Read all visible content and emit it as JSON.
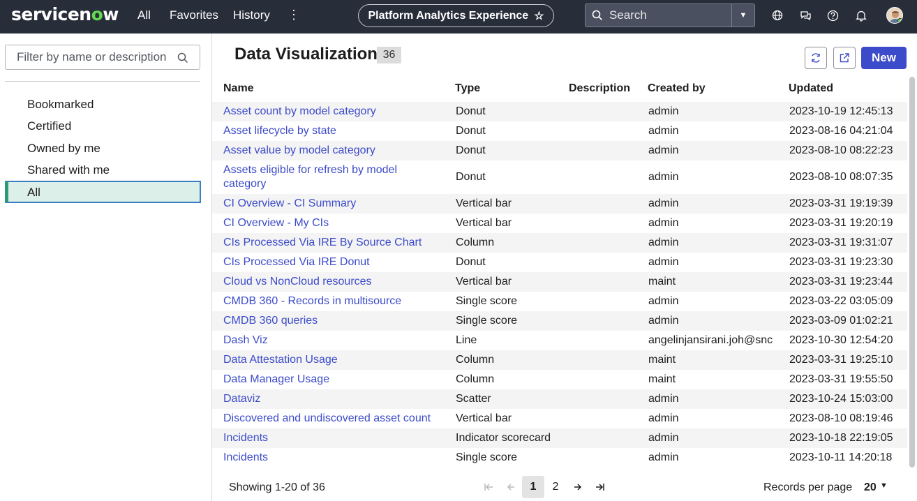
{
  "topbar": {
    "logo_text_pre": "servicen",
    "logo_text_o": "o",
    "logo_text_post": "w",
    "nav": [
      "All",
      "Favorites",
      "History"
    ],
    "app_name": "Platform Analytics Experience",
    "search_placeholder": "Search",
    "colors": {
      "bar": "#282d3a",
      "logo_accent": "#62d84e"
    }
  },
  "sidebar": {
    "filter_placeholder": "Filter by name or description",
    "items": [
      "Bookmarked",
      "Certified",
      "Owned by me",
      "Shared with me",
      "All"
    ],
    "active": "All"
  },
  "main": {
    "title": "Data Visualizations",
    "count": "36",
    "new_label": "New",
    "columns": [
      "Name",
      "Type",
      "Description",
      "Created by",
      "Updated"
    ],
    "rows": [
      {
        "name": "Asset count by model category",
        "type": "Donut",
        "created_by": "admin",
        "updated": "2023-10-19 12:45:13"
      },
      {
        "name": "Asset lifecycle by state",
        "type": "Donut",
        "created_by": "admin",
        "updated": "2023-08-16 04:21:04"
      },
      {
        "name": "Asset value by model category",
        "type": "Donut",
        "created_by": "admin",
        "updated": "2023-08-10 08:22:23"
      },
      {
        "name": "Assets eligible for refresh by model category",
        "type": "Donut",
        "created_by": "admin",
        "updated": "2023-08-10 08:07:35"
      },
      {
        "name": "CI Overview - CI Summary",
        "type": "Vertical bar",
        "created_by": "admin",
        "updated": "2023-03-31 19:19:39"
      },
      {
        "name": "CI Overview - My CIs",
        "type": "Vertical bar",
        "created_by": "admin",
        "updated": "2023-03-31 19:20:19"
      },
      {
        "name": "CIs Processed Via IRE By Source Chart",
        "type": "Column",
        "created_by": "admin",
        "updated": "2023-03-31 19:31:07"
      },
      {
        "name": "CIs Processed Via IRE Donut",
        "type": "Donut",
        "created_by": "admin",
        "updated": "2023-03-31 19:23:30"
      },
      {
        "name": "Cloud vs NonCloud resources",
        "type": "Vertical bar",
        "created_by": "maint",
        "updated": "2023-03-31 19:23:44"
      },
      {
        "name": "CMDB 360 - Records in multisource",
        "type": "Single score",
        "created_by": "admin",
        "updated": "2023-03-22 03:05:09"
      },
      {
        "name": "CMDB 360 queries",
        "type": "Single score",
        "created_by": "admin",
        "updated": "2023-03-09 01:02:21"
      },
      {
        "name": "Dash Viz",
        "type": "Line",
        "created_by": "angelinjansirani.joh@snc",
        "updated": "2023-10-30 12:54:20"
      },
      {
        "name": "Data Attestation Usage",
        "type": "Column",
        "created_by": "maint",
        "updated": "2023-03-31 19:25:10"
      },
      {
        "name": "Data Manager Usage",
        "type": "Column",
        "created_by": "maint",
        "updated": "2023-03-31 19:55:50"
      },
      {
        "name": "Dataviz",
        "type": "Scatter",
        "created_by": "admin",
        "updated": "2023-10-24 15:03:00"
      },
      {
        "name": "Discovered and undiscovered asset count",
        "type": "Vertical bar",
        "created_by": "admin",
        "updated": "2023-08-10 08:19:46"
      },
      {
        "name": "Incidents",
        "type": "Indicator scorecard",
        "created_by": "admin",
        "updated": "2023-10-18 22:19:05"
      },
      {
        "name": "Incidents",
        "type": "Single score",
        "created_by": "admin",
        "updated": "2023-10-11 14:20:18"
      }
    ],
    "link_color": "#3c4bc9"
  },
  "footer": {
    "showing": "Showing 1-20 of 36",
    "pages": [
      "1",
      "2"
    ],
    "current_page": "1",
    "rpp_label": "Records per page",
    "rpp_value": "20"
  }
}
